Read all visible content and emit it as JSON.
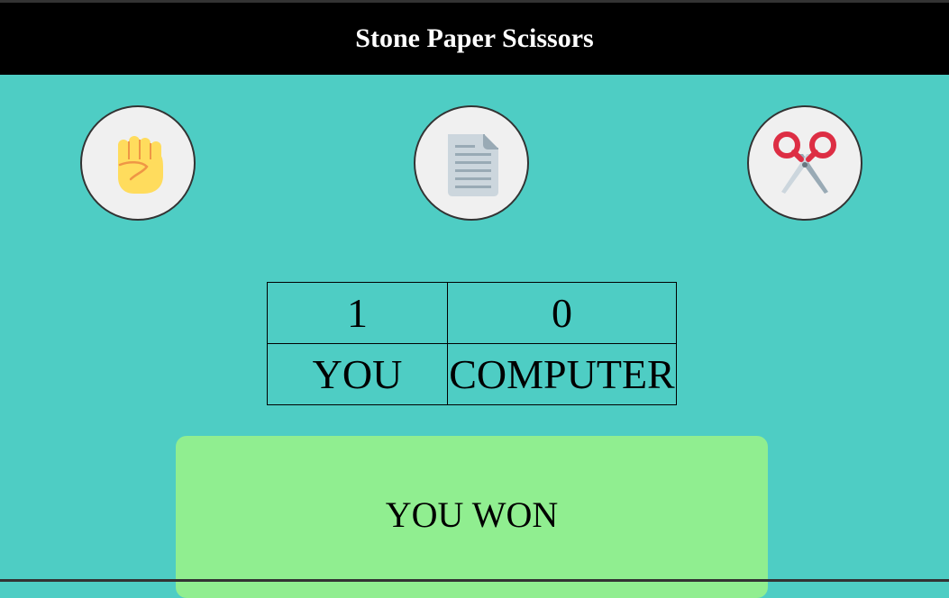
{
  "header": {
    "title": "Stone Paper Scissors"
  },
  "choices": [
    {
      "name": "stone",
      "icon": "fist-icon"
    },
    {
      "name": "paper",
      "icon": "paper-icon"
    },
    {
      "name": "scissors",
      "icon": "scissors-icon"
    }
  ],
  "scoreboard": {
    "user_score": "1",
    "computer_score": "0",
    "user_label": "YOU",
    "computer_label": "COMPUTER"
  },
  "result": {
    "message": "YOU WON",
    "color": "#90ee90"
  },
  "colors": {
    "background": "#4ecdc4",
    "header": "#000000",
    "choice_circle": "#f0f0f0"
  }
}
